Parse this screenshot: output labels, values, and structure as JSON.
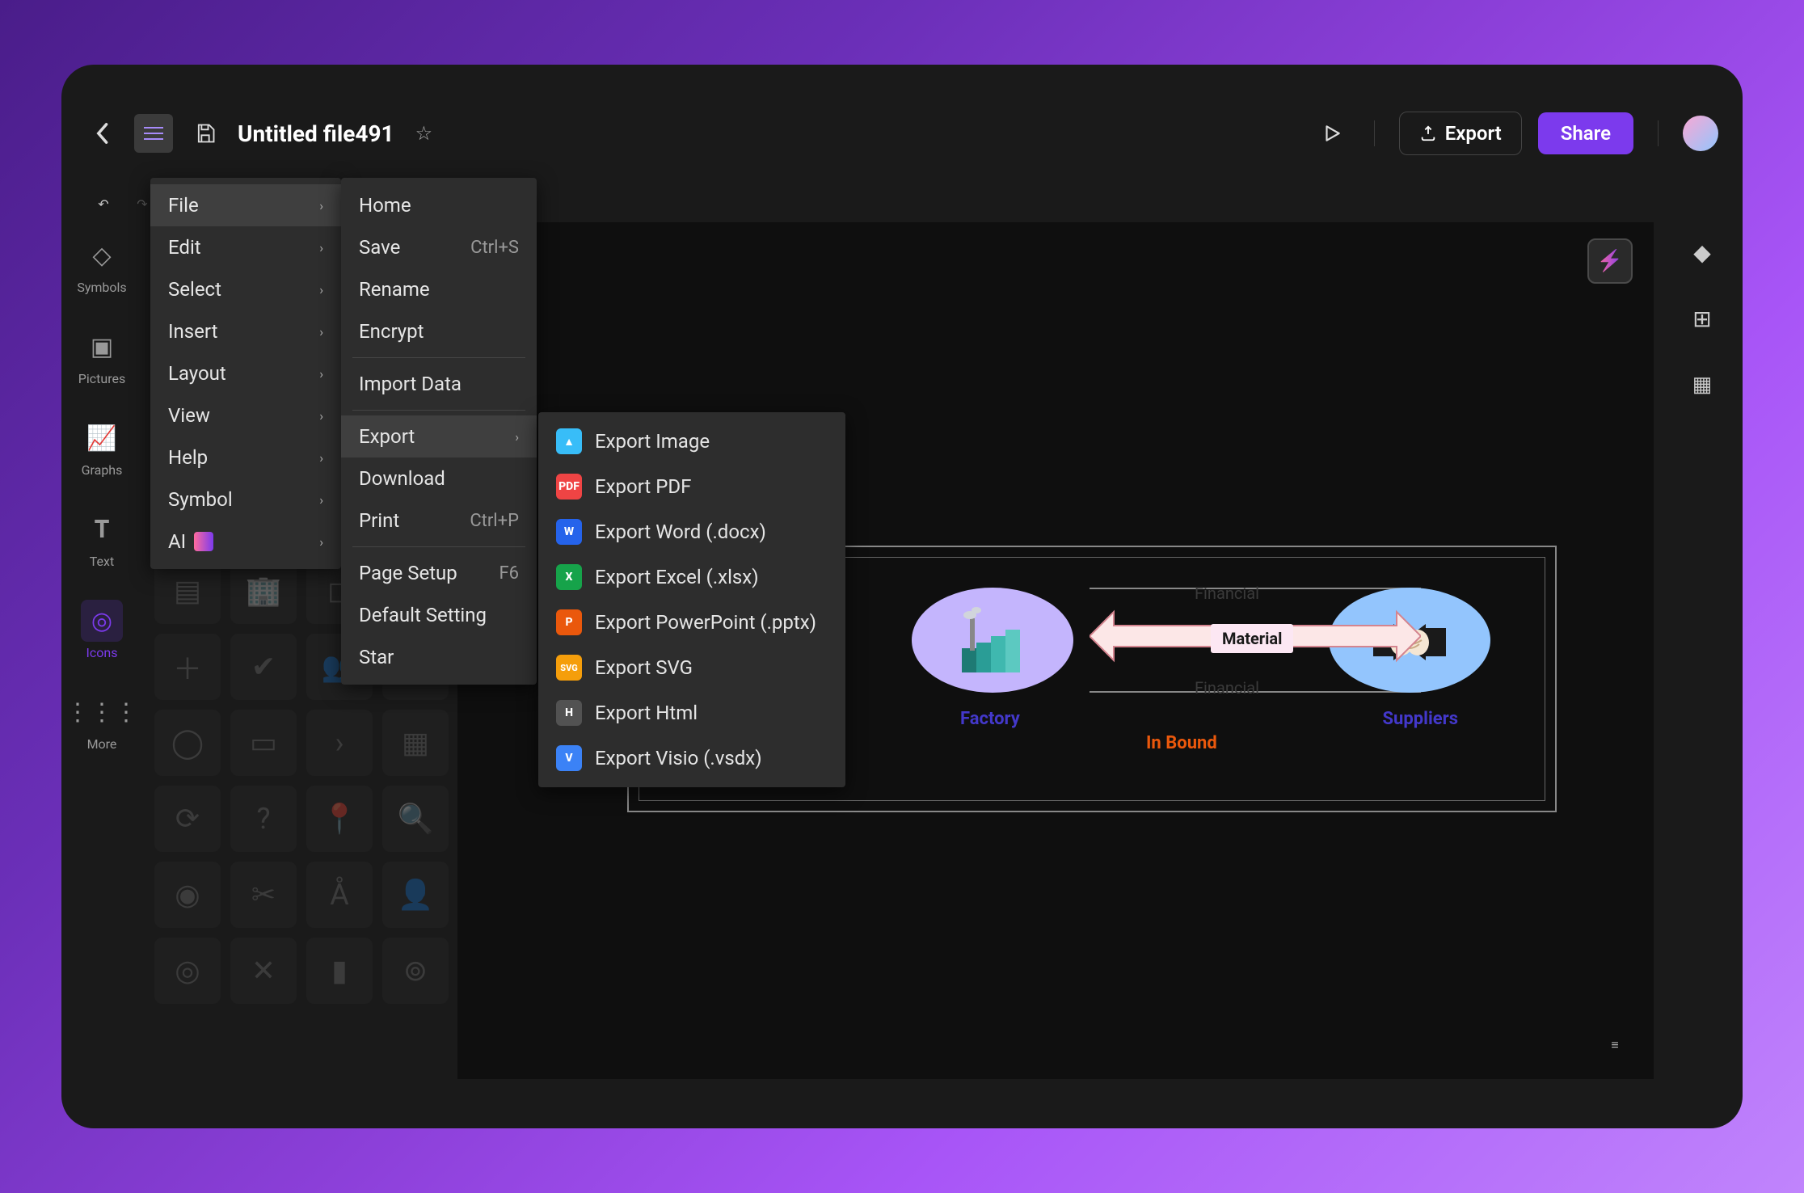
{
  "header": {
    "document_title": "Untitled file491",
    "export_label": "Export",
    "share_label": "Share"
  },
  "left_rail": {
    "items": [
      {
        "label": "Symbols"
      },
      {
        "label": "Pictures"
      },
      {
        "label": "Graphs"
      },
      {
        "label": "Text"
      },
      {
        "label": "Icons"
      },
      {
        "label": "More"
      }
    ]
  },
  "main_menu": {
    "items": [
      "File",
      "Edit",
      "Select",
      "Insert",
      "Layout",
      "View",
      "Help",
      "Symbol",
      "AI"
    ]
  },
  "file_menu": {
    "home": "Home",
    "save": "Save",
    "save_sc": "Ctrl+S",
    "rename": "Rename",
    "encrypt": "Encrypt",
    "import": "Import Data",
    "export": "Export",
    "download": "Download",
    "print": "Print",
    "print_sc": "Ctrl+P",
    "page_setup": "Page Setup",
    "page_setup_sc": "F6",
    "default_setting": "Default Setting",
    "star": "Star"
  },
  "export_menu": {
    "items": [
      {
        "badge": "IMG",
        "label": "Export Image",
        "cls": "bg-img"
      },
      {
        "badge": "PDF",
        "label": "Export PDF",
        "cls": "bg-pdf"
      },
      {
        "badge": "W",
        "label": "Export Word (.docx)",
        "cls": "bg-word"
      },
      {
        "badge": "X",
        "label": "Export Excel (.xlsx)",
        "cls": "bg-xls"
      },
      {
        "badge": "P",
        "label": "Export PowerPoint (.pptx)",
        "cls": "bg-ppt"
      },
      {
        "badge": "SVG",
        "label": "Export SVG",
        "cls": "bg-svg"
      },
      {
        "badge": "H",
        "label": "Export Html",
        "cls": "bg-html"
      },
      {
        "badge": "V",
        "label": "Export Visio (.vsdx)",
        "cls": "bg-vis"
      }
    ]
  },
  "diagram": {
    "factory_label": "Factory",
    "suppliers_label": "Suppliers",
    "material_label": "Material",
    "inbound_label": "In Bound",
    "financial_label": "Financial"
  }
}
